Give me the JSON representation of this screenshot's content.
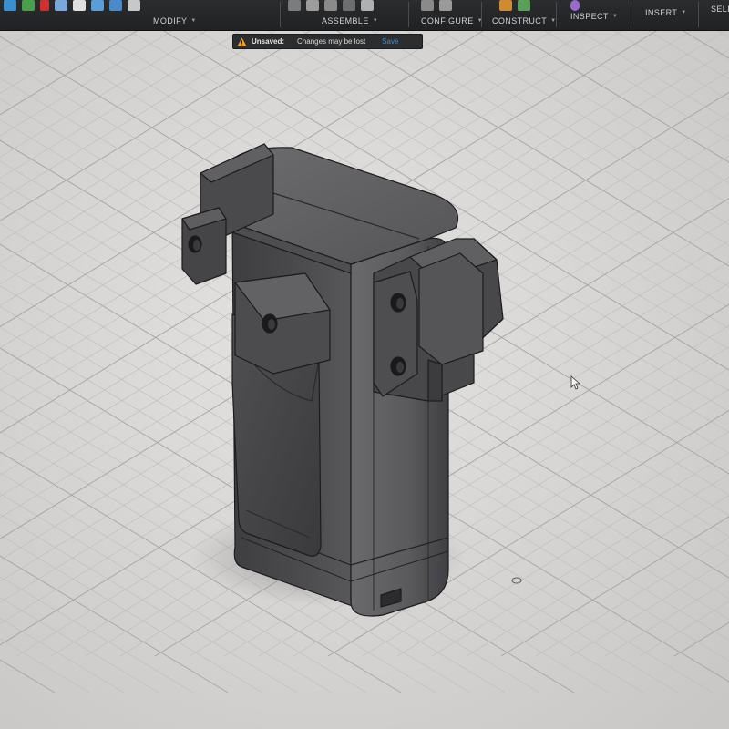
{
  "toolbar": {
    "groups": [
      {
        "label": "MODIFY"
      },
      {
        "label": "ASSEMBLE"
      },
      {
        "label": "CONFIGURE"
      },
      {
        "label": "CONSTRUCT"
      },
      {
        "label": "INSPECT"
      },
      {
        "label": "INSERT"
      },
      {
        "label": "SELE"
      }
    ]
  },
  "notification": {
    "title": "Unsaved:",
    "message": "Changes may be lost",
    "action": "Save"
  },
  "colors": {
    "toolbar_bg": "#232527",
    "grid_bg": "#d8d6d4",
    "model_body": "#58585a",
    "link_blue": "#3d8fd6",
    "warning": "#f0a020"
  },
  "icons": [
    "warning-icon",
    "cursor-arrow-icon"
  ]
}
